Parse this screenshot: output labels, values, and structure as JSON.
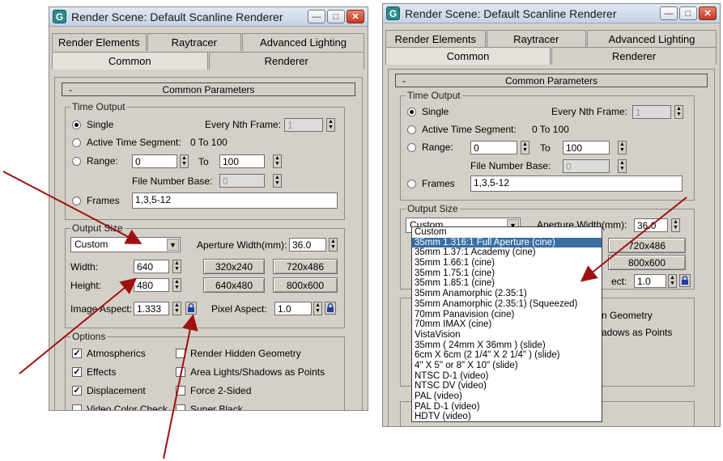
{
  "window_title": "Render Scene: Default Scanline Renderer",
  "title_buttons": {
    "minimize": "—",
    "maximize": "□",
    "close": "✕"
  },
  "tabs_top": [
    "Render Elements",
    "Raytracer",
    "Advanced Lighting"
  ],
  "tabs_bottom": [
    "Common",
    "Renderer"
  ],
  "rollout": {
    "sign": "-",
    "title": "Common Parameters"
  },
  "time_output": {
    "label": "Time Output",
    "single": "Single",
    "every_nth_label": "Every Nth Frame:",
    "every_nth_value": "1",
    "active_segment_label": "Active Time Segment:",
    "active_segment_value": "0 To 100",
    "range_label": "Range:",
    "range_from": "0",
    "range_to_label": "To",
    "range_to": "100",
    "file_number_base_label": "File Number Base:",
    "file_number_base_value": "0",
    "frames_label": "Frames",
    "frames_value": "1,3,5-12"
  },
  "output_size": {
    "label": "Output Size",
    "preset": "Custom",
    "aperture_label": "Aperture Width(mm):",
    "aperture_value": "36.0",
    "width_label": "Width:",
    "width_value": "640",
    "height_label": "Height:",
    "height_value": "480",
    "presets": [
      "320x240",
      "720x486",
      "640x480",
      "800x600"
    ],
    "image_aspect_label": "Image Aspect:",
    "image_aspect_value": "1.333",
    "pixel_aspect_label": "Pixel Aspect:",
    "pixel_aspect_value": "1.0",
    "right_visible_pixel_label": "ect:"
  },
  "options": {
    "label": "Options",
    "atmospherics": "Atmospherics",
    "render_hidden": "Render Hidden Geometry",
    "effects": "Effects",
    "area_lights": "Area Lights/Shadows as Points",
    "displacement": "Displacement",
    "force_2sided": "Force 2-Sided",
    "video_color_check": "Video Color Check",
    "super_black": "Super Black",
    "partial_right_1": "n Geometry",
    "partial_right_2": "adows as Points"
  },
  "dropdown_items": [
    "Custom",
    "35mm 1.316:1 Full Aperture (cine)",
    "35mm 1.37:1 Academy (cine)",
    "35mm 1.66:1 (cine)",
    "35mm 1.75:1 (cine)",
    "35mm 1.85:1 (cine)",
    "35mm Anamorphic (2.35:1)",
    "35mm Anamorphic (2.35:1)  (Squeezed)",
    "70mm Panavision (cine)",
    "70mm IMAX (cine)",
    "VistaVision",
    "35mm ( 24mm X 36mm ) (slide)",
    "6cm  X  6cm  (2  1/4\"  X  2  1/4\" )  (slide)",
    "4\" X 5\"  or  8\" X 10\"  (slide)",
    "NTSC D-1 (video)",
    "NTSC  DV (video)",
    "PAL (video)",
    "PAL D-1 (video)",
    "HDTV (video)"
  ],
  "colors": {
    "dialog_bg": "#d4d0c8",
    "selection": "#3a6ea5",
    "arrow": "#a01010"
  }
}
